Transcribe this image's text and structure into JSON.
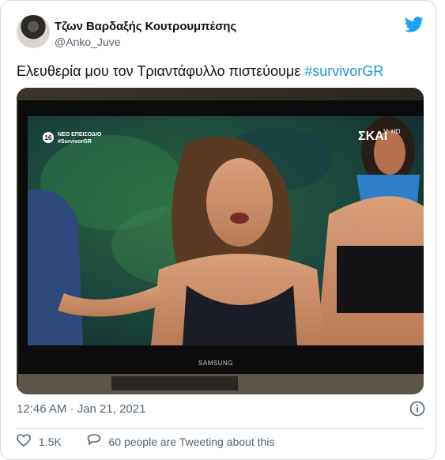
{
  "tweet": {
    "author_name": "Τζων Βαρδαξής Κουτρουμπέσης",
    "author_handle": "@Anko_Juve",
    "text": "Ελευθερία μου τον Τριαντάφυλλο πιστεύουμε ",
    "hashtag": "#survivorGR",
    "timestamp": "12:46 AM · Jan 21, 2021",
    "like_count": "1.5K",
    "activity_text": "60 people are Tweeting about this"
  },
  "media": {
    "badge_age": "16",
    "badge_line1": "ΝΕΟ ΕΠΕΙΣΟΔΙΟ",
    "badge_line2": "#SurvivorGR",
    "channel_logo": "ΣΚΑΪ",
    "channel_suffix": "HD",
    "tv_brand": "SAMSUNG"
  },
  "colors": {
    "brand": "#1da1f2",
    "hashtag": "#1b95e0",
    "secondary_text": "#536471"
  },
  "icons": [
    "twitter-bird-icon",
    "info-icon",
    "heart-icon",
    "reply-icon"
  ]
}
